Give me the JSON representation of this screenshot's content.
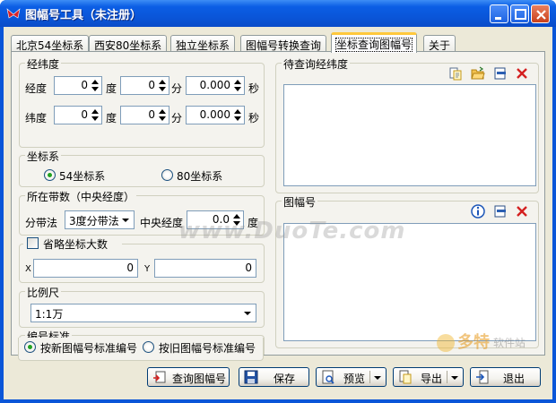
{
  "window": {
    "title": "图幅号工具（未注册）"
  },
  "tabs": [
    {
      "label": "北京54坐标系"
    },
    {
      "label": "西安80坐标系"
    },
    {
      "label": "独立坐标系"
    },
    {
      "label": "图幅号转换查询"
    },
    {
      "label": "坐标查询图幅号",
      "active": true
    },
    {
      "label": "关于"
    }
  ],
  "latlon": {
    "title": "经纬度",
    "rows": [
      {
        "label": "经度",
        "deg": "0",
        "deg_unit": "度",
        "min": "0",
        "min_unit": "分",
        "sec": "0.000",
        "sec_unit": "秒"
      },
      {
        "label": "纬度",
        "deg": "0",
        "deg_unit": "度",
        "min": "0",
        "min_unit": "分",
        "sec": "0.000",
        "sec_unit": "秒"
      }
    ]
  },
  "coord": {
    "title": "坐标系",
    "options": [
      {
        "label": "54坐标系",
        "selected": true
      },
      {
        "label": "80坐标系",
        "selected": false
      }
    ]
  },
  "zone": {
    "title": "所在带数（中央经度）",
    "method_label": "分带法",
    "method_value": "3度分带法",
    "central_label": "中央经度",
    "central_value": "0.0",
    "central_unit": "度"
  },
  "omit": {
    "label": "省略坐标大数",
    "checked": false,
    "x_label": "X",
    "x_value": "0",
    "y_label": "Y",
    "y_value": "0"
  },
  "scale": {
    "title": "比例尺",
    "value": "1:1万"
  },
  "standard": {
    "title": "编号标准",
    "options": [
      {
        "label": "按新图幅号标准编号",
        "selected": true
      },
      {
        "label": "按旧图幅号标准编号",
        "selected": false
      }
    ]
  },
  "pending": {
    "title": "待查询经纬度"
  },
  "sheet": {
    "title": "图幅号"
  },
  "buttons": {
    "query": "查询图幅号",
    "save": "保存",
    "preview": "预览",
    "export": "导出",
    "exit": "退出"
  },
  "watermark": {
    "main": "www.DuoTe.com",
    "brand": "多特",
    "brand_sub": "软件站"
  },
  "colors": {
    "accent_tab": "#ffc83c",
    "titlebar": "#0a54d6",
    "close_button": "#c9401c"
  }
}
